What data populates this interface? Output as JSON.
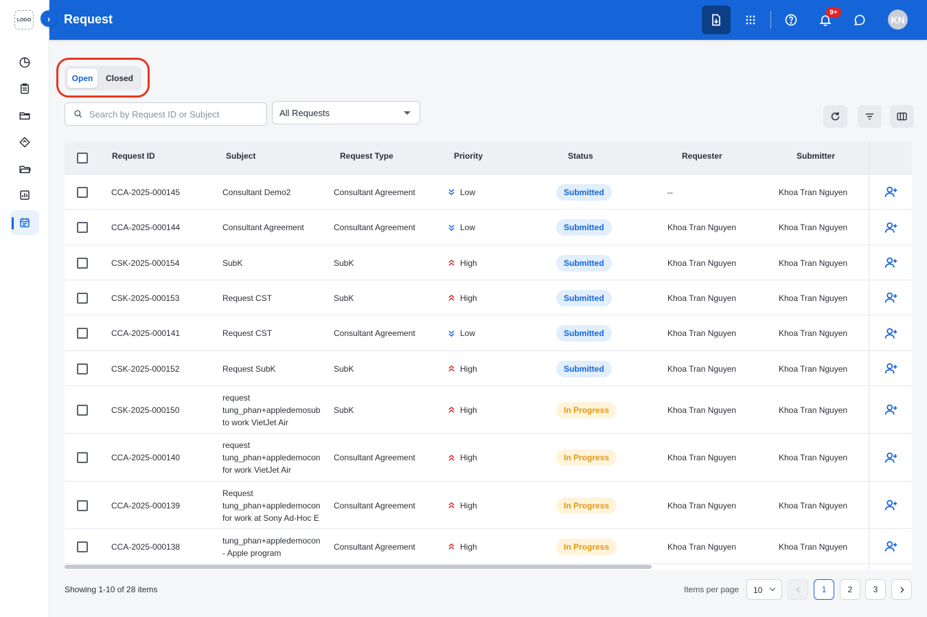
{
  "header": {
    "title": "Request",
    "notification_count": "9+",
    "avatar_initials": "KN"
  },
  "sidebar": {
    "logo_text": "LOGO"
  },
  "tabs": [
    {
      "label": "Open",
      "active": true
    },
    {
      "label": "Closed",
      "active": false
    }
  ],
  "filters": {
    "search_placeholder": "Search by Request ID or Subject",
    "request_filter": "All Requests"
  },
  "table": {
    "columns": [
      "Request ID",
      "Subject",
      "Request Type",
      "Priority",
      "Status",
      "Requester",
      "Submitter"
    ],
    "rows": [
      {
        "id": "CCA-2025-000145",
        "subject": [
          "Consultant Demo2"
        ],
        "type": "Consultant Agreement",
        "priority": "Low",
        "status": "Submitted",
        "requester": "--",
        "submitter": "Khoa Tran Nguyen"
      },
      {
        "id": "CCA-2025-000144",
        "subject": [
          "Consultant Agreement"
        ],
        "type": "Consultant Agreement",
        "priority": "Low",
        "status": "Submitted",
        "requester": "Khoa Tran Nguyen",
        "submitter": "Khoa Tran Nguyen"
      },
      {
        "id": "CSK-2025-000154",
        "subject": [
          "SubK"
        ],
        "type": "SubK",
        "priority": "High",
        "status": "Submitted",
        "requester": "Khoa Tran Nguyen",
        "submitter": "Khoa Tran Nguyen"
      },
      {
        "id": "CSK-2025-000153",
        "subject": [
          "Request CST"
        ],
        "type": "SubK",
        "priority": "High",
        "status": "Submitted",
        "requester": "Khoa Tran Nguyen",
        "submitter": "Khoa Tran Nguyen"
      },
      {
        "id": "CCA-2025-000141",
        "subject": [
          "Request CST"
        ],
        "type": "Consultant Agreement",
        "priority": "Low",
        "status": "Submitted",
        "requester": "Khoa Tran Nguyen",
        "submitter": "Khoa Tran Nguyen"
      },
      {
        "id": "CSK-2025-000152",
        "subject": [
          "Request SubK"
        ],
        "type": "SubK",
        "priority": "High",
        "status": "Submitted",
        "requester": "Khoa Tran Nguyen",
        "submitter": "Khoa Tran Nguyen"
      },
      {
        "id": "CSK-2025-000150",
        "subject": [
          "request",
          "tung_phan+appledemosub",
          "to work VietJet Air"
        ],
        "type": "SubK",
        "priority": "High",
        "status": "In Progress",
        "requester": "Khoa Tran Nguyen",
        "submitter": "Khoa Tran Nguyen"
      },
      {
        "id": "CCA-2025-000140",
        "subject": [
          "request",
          "tung_phan+appledemocon",
          "for work VietJet Air"
        ],
        "type": "Consultant Agreement",
        "priority": "High",
        "status": "In Progress",
        "requester": "Khoa Tran Nguyen",
        "submitter": "Khoa Tran Nguyen"
      },
      {
        "id": "CCA-2025-000139",
        "subject": [
          "Request",
          "tung_phan+appledemocon",
          "for work at Sony Ad-Hoc E"
        ],
        "type": "Consultant Agreement",
        "priority": "High",
        "status": "In Progress",
        "requester": "Khoa Tran Nguyen",
        "submitter": "Khoa Tran Nguyen"
      },
      {
        "id": "CCA-2025-000138",
        "subject": [
          "tung_phan+appledemocon",
          "- Apple program"
        ],
        "type": "Consultant Agreement",
        "priority": "High",
        "status": "In Progress",
        "requester": "Khoa Tran Nguyen",
        "submitter": "Khoa Tran Nguyen"
      }
    ]
  },
  "footer": {
    "showing": "Showing 1-10 of 28 items",
    "items_per_page_label": "Items per page",
    "items_per_page": "10",
    "pages": [
      "1",
      "2",
      "3"
    ],
    "current_page": "1"
  },
  "colors": {
    "brand": "#1565d8",
    "header_dark": "#0d3f86",
    "submitted_bg": "#e1eefc",
    "inprogress_bg": "#fff3da",
    "inprogress_text": "#e39a0e",
    "highlight": "#e8361e"
  }
}
